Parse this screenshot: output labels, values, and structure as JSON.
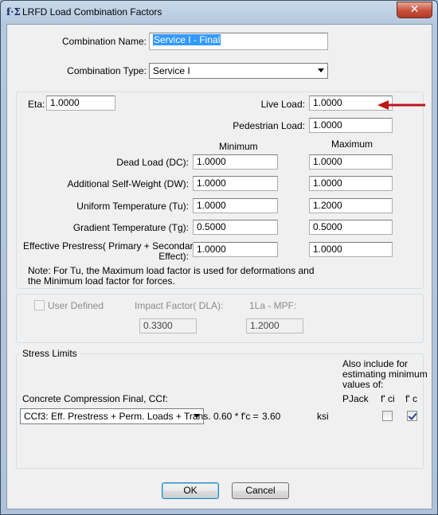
{
  "window": {
    "title": "LRFD Load Combination Factors",
    "icon": "fsigma-app-icon",
    "close_label": "✕"
  },
  "combination": {
    "name_label": "Combination Name:",
    "name_value": "Service I - Final",
    "type_label": "Combination Type:",
    "type_value": "Service I"
  },
  "factors": {
    "eta_label": "Eta:",
    "eta_value": "1.0000",
    "live_load_label": "Live Load:",
    "live_load_value": "1.0000",
    "pedestrian_label": "Pedestrian Load:",
    "pedestrian_value": "1.0000",
    "minimum_header": "Minimum",
    "maximum_header": "Maximum",
    "rows": [
      {
        "label": "Dead Load (DC):",
        "min": "1.0000",
        "max": "1.0000"
      },
      {
        "label": "Additional Self-Weight (DW):",
        "min": "1.0000",
        "max": "1.0000"
      },
      {
        "label": "Uniform Temperature (Tu):",
        "min": "1.0000",
        "max": "1.2000"
      },
      {
        "label": "Gradient Temperature (Tg):",
        "min": "0.5000",
        "max": "0.5000"
      }
    ],
    "prestress_label_1": "Effective Prestress( Primary + Secondary",
    "prestress_label_2": "Effect):",
    "prestress_min": "1.0000",
    "prestress_max": "1.0000",
    "note_1": "Note: For Tu, the Maximum load factor is used for deformations and",
    "note_2": "the Minimum load factor for forces."
  },
  "impact": {
    "user_defined_label": "User Defined",
    "impact_label": "Impact Factor( DLA):",
    "impact_value": "0.3300",
    "mpf_label": "1La - MPF:",
    "mpf_value": "1.2000"
  },
  "stress": {
    "group_title": "Stress Limits",
    "also_include_1": "Also include for",
    "also_include_2": "estimating minimum",
    "also_include_3": "values of:",
    "ccf_label": "Concrete Compression Final, CCf:",
    "pjack_label": "PJack",
    "fci_label": "f' ci",
    "fc_label": "f' c",
    "ccf_value": "CCf3: Eff. Prestress + Perm. Loads + Trans.",
    "formula": "0.60 * f'c =",
    "result": "3.60",
    "unit": "ksi",
    "fci_checked": false,
    "fc_checked": true
  },
  "buttons": {
    "ok": "OK",
    "cancel": "Cancel"
  },
  "colors": {
    "annotation_arrow": "#c0161a",
    "selection": "#3399ff"
  }
}
